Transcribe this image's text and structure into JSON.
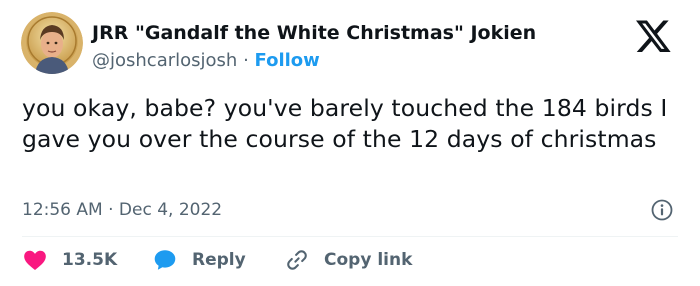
{
  "author": {
    "display_name": "JRR \"Gandalf the White Christmas\" Jokien",
    "handle": "@joshcarlosjosh",
    "separator": "·",
    "follow_label": "Follow"
  },
  "tweet": {
    "text": "you okay, babe? you've barely touched the 184 birds I gave you over the course of the 12 days of christmas",
    "time": "12:56 AM",
    "date_separator": "·",
    "date": "Dec 4, 2022"
  },
  "actions": {
    "likes_count": "13.5K",
    "reply_label": "Reply",
    "copy_link_label": "Copy link"
  },
  "icons": {
    "platform": "x-logo-icon",
    "info": "info-icon",
    "like": "heart-icon",
    "reply": "speech-bubble-icon",
    "copy": "link-icon"
  },
  "colors": {
    "text_primary": "#0f1419",
    "text_secondary": "#536471",
    "accent_blue": "#1d9bf0",
    "like_red": "#f91880"
  }
}
